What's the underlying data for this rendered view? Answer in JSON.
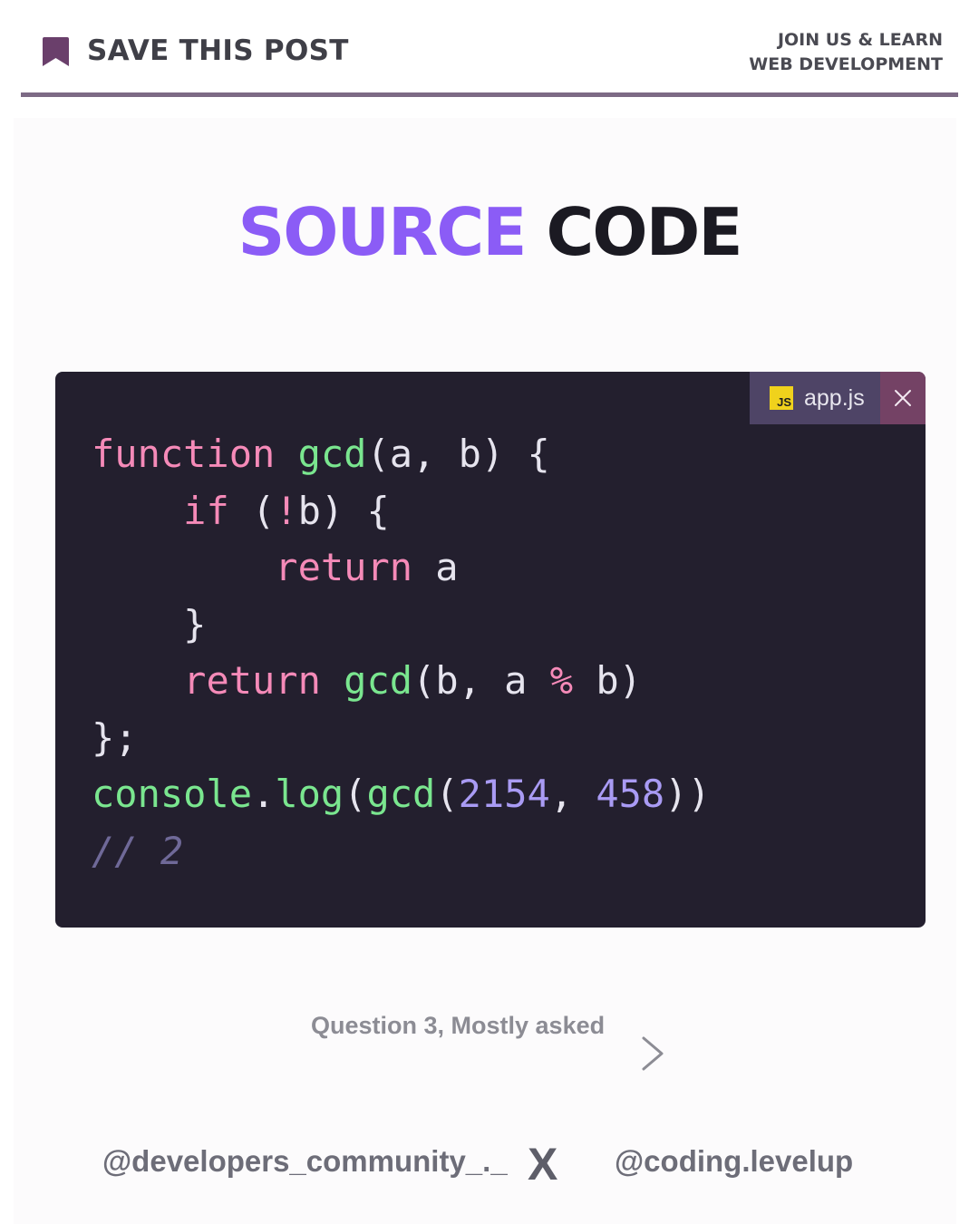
{
  "header": {
    "save_label": "SAVE THIS POST",
    "join_line1": "JOIN US & LEARN",
    "join_line2": "WEB DEVELOPMENT"
  },
  "title": {
    "word1": "SOURCE",
    "word2": "CODE",
    "word1_color": "#8b5cf6",
    "word2_color": "#1b1a22"
  },
  "editor": {
    "tab_badge": "JS",
    "tab_name": "app.js",
    "close_icon": "close-icon",
    "code": {
      "l1_kw": "function",
      "l1_fn": "gcd",
      "l1_rest": "(a, b) {",
      "l2_indent": "    ",
      "l2_kw": "if",
      "l2_a": " (",
      "l2_bang": "!",
      "l2_b": "b) {",
      "l3_indent": "        ",
      "l3_kw": "return",
      "l3_rest": " a",
      "l4": "    }",
      "l5_indent": "    ",
      "l5_kw": "return",
      "l5_sp": " ",
      "l5_fn": "gcd",
      "l5_a": "(b, a ",
      "l5_op": "%",
      "l5_b": " b)",
      "l6": "};",
      "l7_fn1": "console",
      "l7_dot": ".",
      "l7_fn2": "log",
      "l7_p1": "(",
      "l7_fn3": "gcd",
      "l7_p2": "(",
      "l7_n1": "2154",
      "l7_comma": ", ",
      "l7_n2": "458",
      "l7_p3": "))",
      "l8_comment": "// 2"
    }
  },
  "question": "Question 3, Mostly asked",
  "footer": {
    "left_handle": "@developers_community_._",
    "separator": "X",
    "right_handle": "@coding.levelup"
  },
  "colors": {
    "accent": "#8b5cf6",
    "divider": "#7d6a85",
    "editor_bg": "#231f2e",
    "keyword": "#f58ab8",
    "function": "#7ae68f",
    "number": "#a99bf4"
  }
}
